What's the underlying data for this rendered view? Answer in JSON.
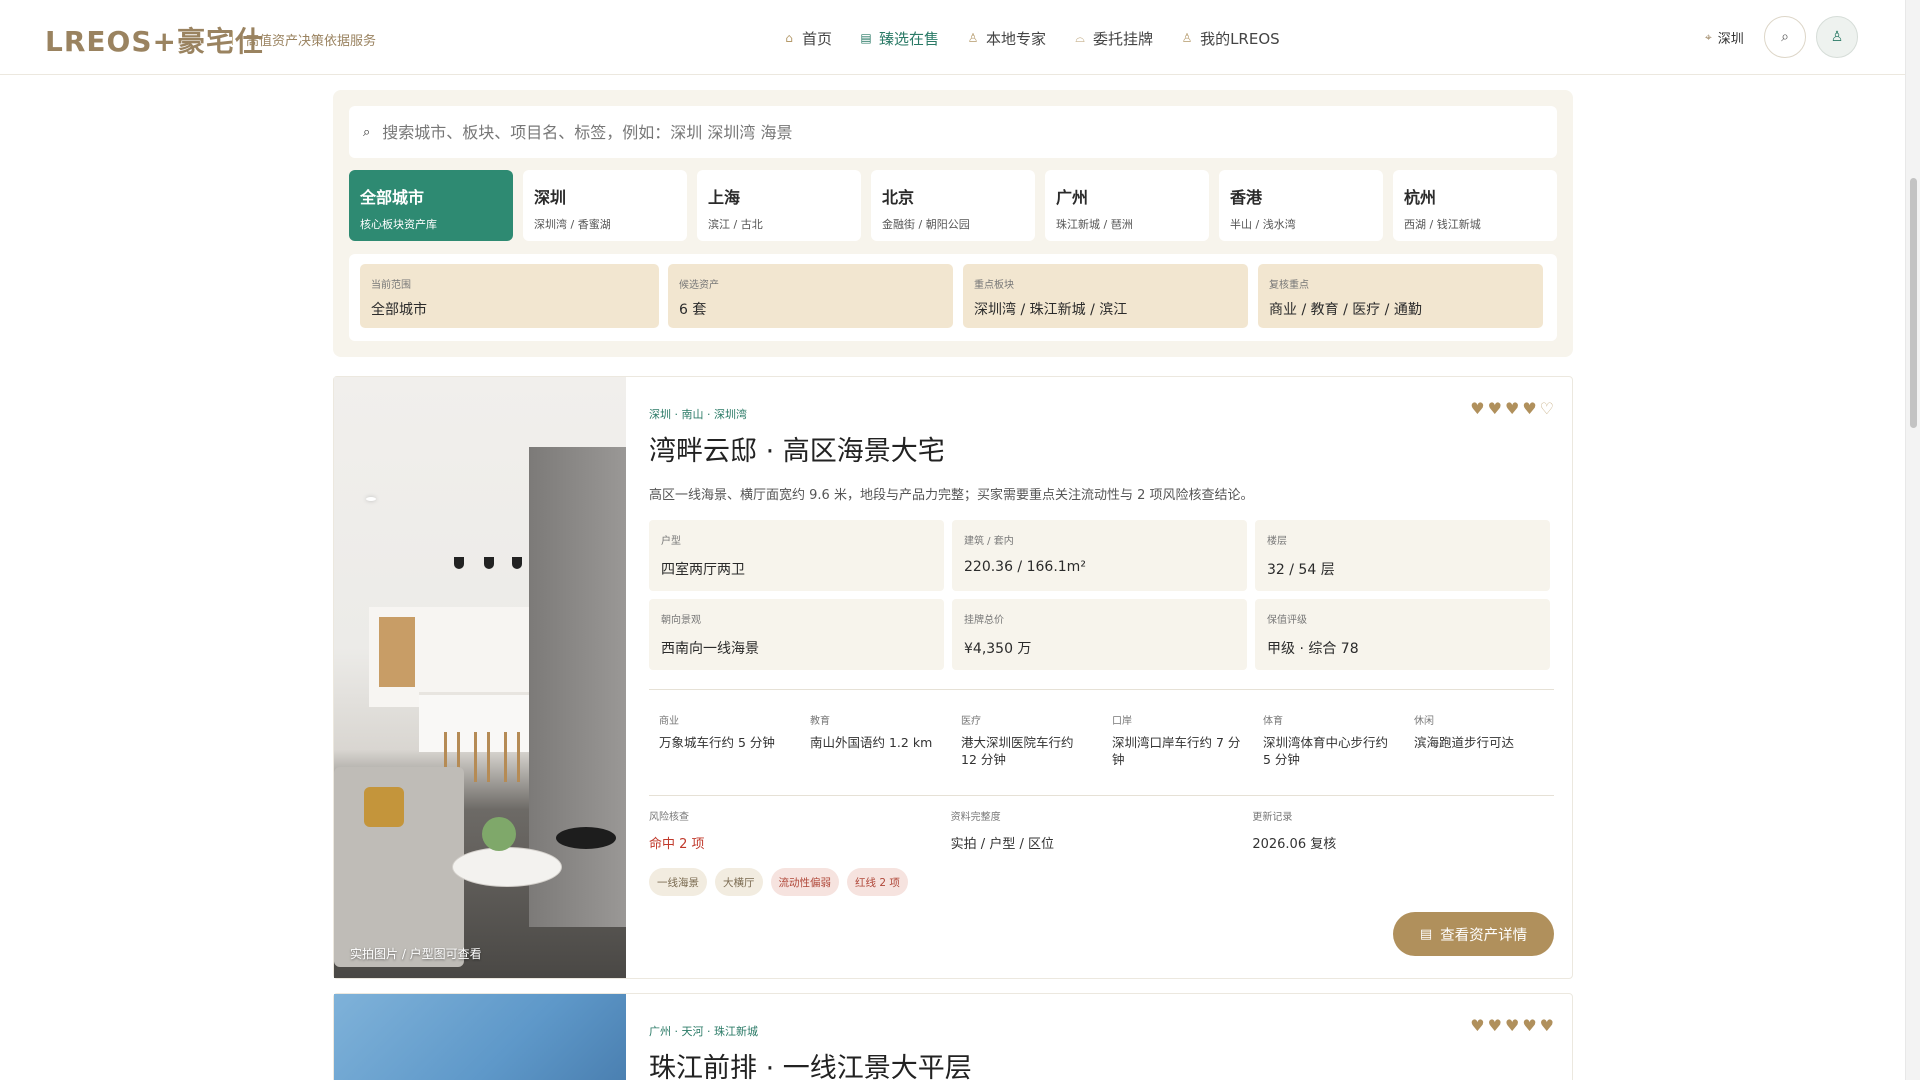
{
  "header": {
    "logo": "LREOS+豪宅仕",
    "tagline": "高值资产决策依据服务",
    "nav": [
      {
        "label": "首页",
        "icon": "home-icon",
        "glyph": "⌂",
        "active": false
      },
      {
        "label": "臻选在售",
        "icon": "document-icon",
        "glyph": "▤",
        "active": true
      },
      {
        "label": "本地专家",
        "icon": "person-icon",
        "glyph": "♙",
        "active": false
      },
      {
        "label": "委托挂牌",
        "icon": "bell-icon",
        "glyph": "⌓",
        "active": false
      },
      {
        "label": "我的LREOS",
        "icon": "person-icon",
        "glyph": "♙",
        "active": false
      }
    ],
    "city": "深圳"
  },
  "search": {
    "placeholder": "搜索城市、板块、项目名、标签，例如：深圳 深圳湾 海景"
  },
  "city_tabs": [
    {
      "name": "全部城市",
      "sub": "核心板块资产库",
      "active": true
    },
    {
      "name": "深圳",
      "sub": "深圳湾 / 香蜜湖",
      "active": false
    },
    {
      "name": "上海",
      "sub": "滨江 / 古北",
      "active": false
    },
    {
      "name": "北京",
      "sub": "金融街 / 朝阳公园",
      "active": false
    },
    {
      "name": "广州",
      "sub": "珠江新城 / 琶洲",
      "active": false
    },
    {
      "name": "香港",
      "sub": "半山 / 浅水湾",
      "active": false
    },
    {
      "name": "杭州",
      "sub": "西湖 / 钱江新城",
      "active": false
    }
  ],
  "summary": [
    {
      "label": "当前范围",
      "value": "全部城市"
    },
    {
      "label": "候选资产",
      "value": "6 套"
    },
    {
      "label": "重点板块",
      "value": "深圳湾 / 珠江新城 / 滨江"
    },
    {
      "label": "复核重点",
      "value": "商业 / 教育 / 医疗 / 通勤"
    }
  ],
  "listing1": {
    "breadcrumb": "深圳 · 南山 · 深圳湾",
    "rating": 4,
    "rating_max": 5,
    "title": "湾畔云邸 · 高区海景大宅",
    "desc": "高区一线海景、横厅面宽约 9.6 米，地段与产品力完整；买家需要重点关注流动性与 2 项风险核查结论。",
    "image_caption": "实拍图片 / 户型图可查看",
    "specs": [
      {
        "label": "户型",
        "value": "四室两厅两卫"
      },
      {
        "label": "建筑 / 套内",
        "value": "220.36 / 166.1m²"
      },
      {
        "label": "楼层",
        "value": "32 / 54 层"
      },
      {
        "label": "朝向景观",
        "value": "西南向一线海景"
      },
      {
        "label": "挂牌总价",
        "value": "¥4,350 万"
      },
      {
        "label": "保值评级",
        "value": "甲级 · 综合 78"
      }
    ],
    "amenities": [
      {
        "label": "商业",
        "value": "万象城车行约 5 分钟"
      },
      {
        "label": "教育",
        "value": "南山外国语约 1.2 km"
      },
      {
        "label": "医疗",
        "value": "港大深圳医院车行约 12 分钟"
      },
      {
        "label": "口岸",
        "value": "深圳湾口岸车行约 7 分钟"
      },
      {
        "label": "体育",
        "value": "深圳湾体育中心步行约 5 分钟"
      },
      {
        "label": "休闲",
        "value": "滨海跑道步行可达"
      }
    ],
    "meta": [
      {
        "label": "风险核查",
        "value": "命中 2 项",
        "alert": true
      },
      {
        "label": "资料完整度",
        "value": "实拍 / 户型 / 区位",
        "alert": false
      },
      {
        "label": "更新记录",
        "value": "2026.06 复核",
        "alert": false
      }
    ],
    "tags": [
      {
        "text": "一线海景",
        "alert": false
      },
      {
        "text": "大横厅",
        "alert": false
      },
      {
        "text": "流动性偏弱",
        "alert": true
      },
      {
        "text": "红线 2 项",
        "alert": true
      }
    ],
    "detail_button": "查看资产详情"
  },
  "listing2": {
    "breadcrumb": "广州 · 天河 · 珠江新城",
    "rating": 5,
    "rating_max": 5,
    "title": "珠江前排 · 一线江景大平层"
  },
  "colors": {
    "accent_green": "#2e8a72",
    "accent_gold": "#b0905c",
    "alert_red": "#c0392b"
  }
}
